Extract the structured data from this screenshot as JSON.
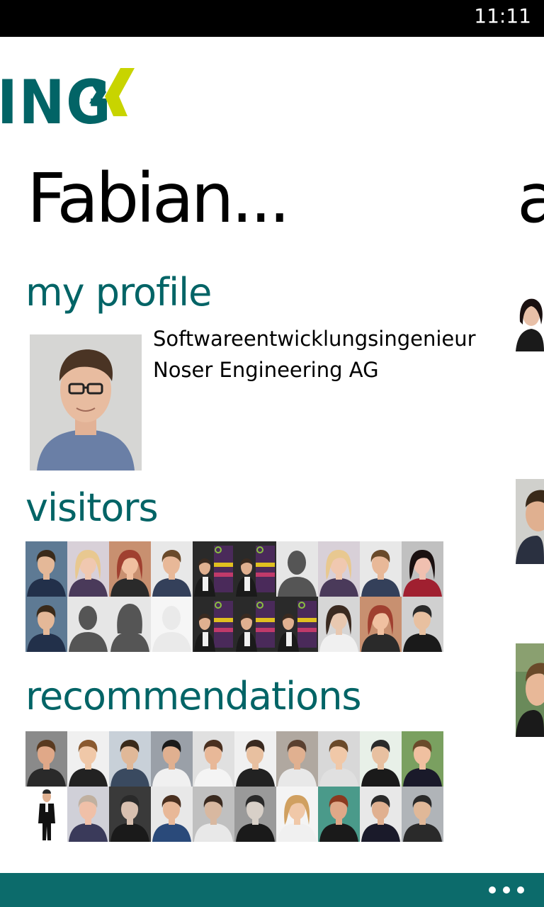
{
  "status_bar": {
    "time": "11:11"
  },
  "logo": {
    "text": "ING"
  },
  "page": {
    "title": "Fabian...",
    "next_pivot_peek": "a"
  },
  "sections": {
    "profile": {
      "heading": "my profile",
      "job_title": "Softwareentwicklungsingenieur",
      "company": "Noser Engineering AG"
    },
    "visitors": {
      "heading": "visitors",
      "tiles": [
        {
          "bg": "#5e7a94",
          "skin": "#e4b898",
          "hair": "#3a2a1a",
          "cloth": "#22304a",
          "kind": "man"
        },
        {
          "bg": "#d8d0d8",
          "skin": "#f0c8b0",
          "hair": "#e8c890",
          "cloth": "#4a3a5a",
          "kind": "woman"
        },
        {
          "bg": "#c89070",
          "skin": "#f0c0a0",
          "hair": "#a04030",
          "cloth": "#2a2a2a",
          "kind": "woman"
        },
        {
          "bg": "#e8e8e8",
          "skin": "#e8b898",
          "hair": "#6a4a2a",
          "cloth": "#34405a",
          "kind": "man"
        },
        {
          "bg": "#2a2a2a",
          "skin": "#e0b090",
          "hair": "#3a2a20",
          "cloth": "#222",
          "kind": "banner"
        },
        {
          "bg": "#2a2a2a",
          "skin": "#e0b090",
          "hair": "#3a2a20",
          "cloth": "#222",
          "kind": "banner"
        },
        {
          "bg": "#e6e6e6",
          "skin": "#555555",
          "hair": "#555555",
          "cloth": "#555555",
          "kind": "silhouette"
        },
        {
          "bg": "#d8d0d8",
          "skin": "#f0c8b0",
          "hair": "#e8c890",
          "cloth": "#4a3a5a",
          "kind": "woman"
        },
        {
          "bg": "#e8e8e8",
          "skin": "#e8b898",
          "hair": "#6a4a2a",
          "cloth": "#34405a",
          "kind": "man"
        },
        {
          "bg": "#c0c0c0",
          "skin": "#f0c0b0",
          "hair": "#1a1010",
          "cloth": "#a02030",
          "kind": "woman"
        },
        {
          "bg": "#5e7a94",
          "skin": "#e4b898",
          "hair": "#3a2a1a",
          "cloth": "#22304a",
          "kind": "man"
        },
        {
          "bg": "#e6e6e6",
          "skin": "#555555",
          "hair": "#555555",
          "cloth": "#555555",
          "kind": "silhouette"
        },
        {
          "bg": "#e6e6e6",
          "skin": "#555555",
          "hair": "#555555",
          "cloth": "#555555",
          "kind": "silhouette-f"
        },
        {
          "bg": "#f6f6f6",
          "skin": "#eaeaea",
          "hair": "#eaeaea",
          "cloth": "#eaeaea",
          "kind": "silhouette"
        },
        {
          "bg": "#2a2a2a",
          "skin": "#e0b090",
          "hair": "#3a2a20",
          "cloth": "#222",
          "kind": "banner"
        },
        {
          "bg": "#2a2a2a",
          "skin": "#e0b090",
          "hair": "#3a2a20",
          "cloth": "#222",
          "kind": "banner"
        },
        {
          "bg": "#2a2a2a",
          "skin": "#e0b090",
          "hair": "#3a2a20",
          "cloth": "#222",
          "kind": "banner"
        },
        {
          "bg": "#d6d6d6",
          "skin": "#e8c8b0",
          "hair": "#3a2a20",
          "cloth": "#f0f0f0",
          "kind": "woman"
        },
        {
          "bg": "#c89070",
          "skin": "#f0c0a0",
          "hair": "#a04030",
          "cloth": "#2a2a2a",
          "kind": "woman"
        },
        {
          "bg": "#d0d0d0",
          "skin": "#e8c0a0",
          "hair": "#2a2a2a",
          "cloth": "#1a1a1a",
          "kind": "man"
        }
      ]
    },
    "recommendations": {
      "heading": "recommendations",
      "tiles": [
        {
          "bg": "#8a8a8a",
          "skin": "#e0a888",
          "hair": "#5a3a20",
          "cloth": "#2a2a2a",
          "kind": "man"
        },
        {
          "bg": "#f0f0f0",
          "skin": "#f0c8a8",
          "hair": "#8a5a30",
          "cloth": "#222",
          "kind": "man"
        },
        {
          "bg": "#c8d0d8",
          "skin": "#e0b898",
          "hair": "#3a2a1a",
          "cloth": "#3a4a60",
          "kind": "man"
        },
        {
          "bg": "#9aa0a8",
          "skin": "#e0b090",
          "hair": "#1a1a1a",
          "cloth": "#f0f0f0",
          "kind": "man"
        },
        {
          "bg": "#e0e0e0",
          "skin": "#e8b898",
          "hair": "#4a3020",
          "cloth": "#f4f4f4",
          "kind": "man"
        },
        {
          "bg": "#f0f0f0",
          "skin": "#e8c0a0",
          "hair": "#3a2a20",
          "cloth": "#222",
          "kind": "man"
        },
        {
          "bg": "#b0a8a0",
          "skin": "#e0b090",
          "hair": "#5a4030",
          "cloth": "#e8e8e8",
          "kind": "man"
        },
        {
          "bg": "#d8d8d8",
          "skin": "#f0c8a8",
          "hair": "#6a4a2a",
          "cloth": "#e0e0e0",
          "kind": "man"
        },
        {
          "bg": "#e8f0e8",
          "skin": "#e8c0a0",
          "hair": "#2a2a2a",
          "cloth": "#1a1a1a",
          "kind": "man"
        },
        {
          "bg": "#7aa060",
          "skin": "#f0c0a0",
          "hair": "#6a4a2a",
          "cloth": "#1a1a2a",
          "kind": "man"
        },
        {
          "bg": "#ffffff",
          "skin": "#e0b090",
          "hair": "#2a2a2a",
          "cloth": "#111",
          "kind": "standing"
        },
        {
          "bg": "#d0d0d8",
          "skin": "#f0c0a8",
          "hair": "#c0b0a0",
          "cloth": "#3a3a5a",
          "kind": "man"
        },
        {
          "bg": "#3a3a3a",
          "skin": "#d8c0b0",
          "hair": "#2a2a2a",
          "cloth": "#1a1a1a",
          "kind": "man"
        },
        {
          "bg": "#e8e8e8",
          "skin": "#e8b898",
          "hair": "#4a3020",
          "cloth": "#2a4a7a",
          "kind": "man"
        },
        {
          "bg": "#c0c0c0",
          "skin": "#d8b8a0",
          "hair": "#3a2a20",
          "cloth": "#e8e8e8",
          "kind": "man"
        },
        {
          "bg": "#9a9a9a",
          "skin": "#d8d0c8",
          "hair": "#2a2a2a",
          "cloth": "#1a1a1a",
          "kind": "man"
        },
        {
          "bg": "#f4f4f4",
          "skin": "#f0c8a8",
          "hair": "#d0a060",
          "cloth": "#f0f0f0",
          "kind": "woman"
        },
        {
          "bg": "#4a9a8a",
          "skin": "#e0a888",
          "hair": "#8a3a20",
          "cloth": "#1a1a1a",
          "kind": "man"
        },
        {
          "bg": "#e8e8e8",
          "skin": "#e0b090",
          "hair": "#2a2a2a",
          "cloth": "#1a1a2a",
          "kind": "man"
        },
        {
          "bg": "#b0b4b8",
          "skin": "#e0b898",
          "hair": "#2a2a2a",
          "cloth": "#2a2a2a",
          "kind": "man"
        }
      ]
    }
  },
  "colors": {
    "accent": "#026466",
    "app_bar": "#0c6b6b",
    "logo_mark": "#c8d400"
  },
  "app_bar": {
    "more_icon": "ellipsis-icon"
  }
}
